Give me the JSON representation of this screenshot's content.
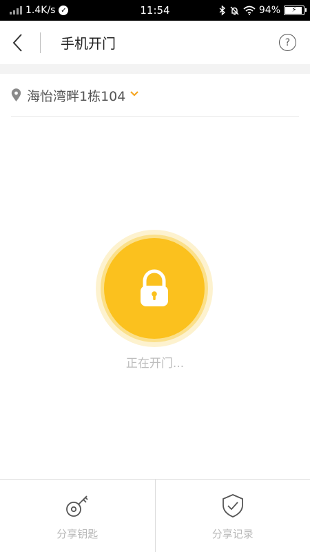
{
  "status_bar": {
    "net_speed": "1.4K/s",
    "time": "11:54",
    "battery_percent": "94%",
    "battery_level": 0.94,
    "icons": [
      "signal-icon",
      "check-circle-icon",
      "bluetooth-icon",
      "mute-bell-icon",
      "wifi-icon",
      "battery-icon"
    ]
  },
  "header": {
    "title": "手机开门",
    "help_label": "?"
  },
  "location": {
    "name": "海怡湾畔1栋104",
    "accent_color": "#F5A623"
  },
  "lock": {
    "status_text": "正在开门...",
    "color": "#FBC11E"
  },
  "bottom_bar": {
    "items": [
      {
        "label": "分享钥匙",
        "icon": "key-icon"
      },
      {
        "label": "分享记录",
        "icon": "shield-check-icon"
      }
    ]
  }
}
